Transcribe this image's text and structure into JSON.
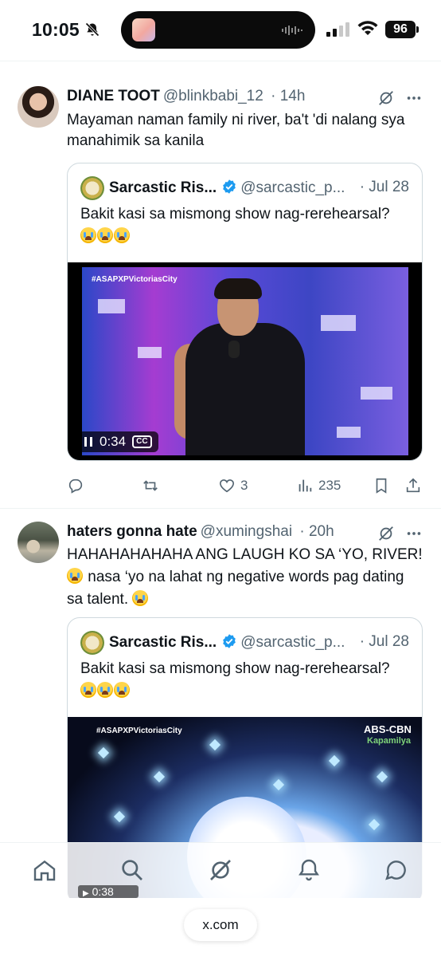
{
  "status_bar": {
    "time": "10:05",
    "battery": "96"
  },
  "tweets": [
    {
      "name": "DIANE TOOT",
      "handle": "@blinkbabi_12",
      "age": "· 14h",
      "text": "Mayaman naman family ni river, ba't 'di nalang sya manahimik sa kanila",
      "quote": {
        "name": "Sarcastic Ris...",
        "handle": "@sarcastic_p...",
        "date": "· Jul 28",
        "text": "Bakit kasi sa mismong show nag-rerehearsal?",
        "video_overlay": "#ASAPXPVictoriasCity",
        "video_time": "0:34",
        "cc_label": "CC"
      },
      "actions": {
        "likes": "3",
        "views": "235"
      }
    },
    {
      "name": "haters gonna hate",
      "handle": "@xumingshai",
      "age": "· 20h",
      "text_line1": "HAHAHAHAHAHA ANG LAUGH KO SA ‘YO, RIVER!",
      "text_line2": "nasa ‘yo na lahat ng negative words pag dating",
      "text_line3": "sa talent.",
      "quote": {
        "name": "Sarcastic Ris...",
        "handle": "@sarcastic_p...",
        "date": "· Jul 28",
        "text": "Bakit kasi sa mismong show nag-rerehearsal?",
        "video_overlay": "#ASAPXPVictoriasCity",
        "video_time": "0:38",
        "network_label": "ABS-CBN",
        "network_sub": "Kapamilya"
      }
    }
  ],
  "browser": {
    "url": "x.com"
  },
  "icons": {
    "bell_off": "bell-slash-icon",
    "grok": "grok-icon",
    "more": "more-icon",
    "verified": "verified-badge-icon",
    "reply": "reply-icon",
    "repost": "repost-icon",
    "like": "heart-icon",
    "views": "views-icon",
    "bookmark": "bookmark-icon",
    "share": "share-icon",
    "home": "home-icon",
    "search": "search-icon",
    "grok_nav": "grok-icon",
    "notifications": "bell-icon",
    "messages": "messages-icon"
  },
  "colors": {
    "verified": "#1d9bf0",
    "text": "#0f1419",
    "muted": "#536471"
  }
}
